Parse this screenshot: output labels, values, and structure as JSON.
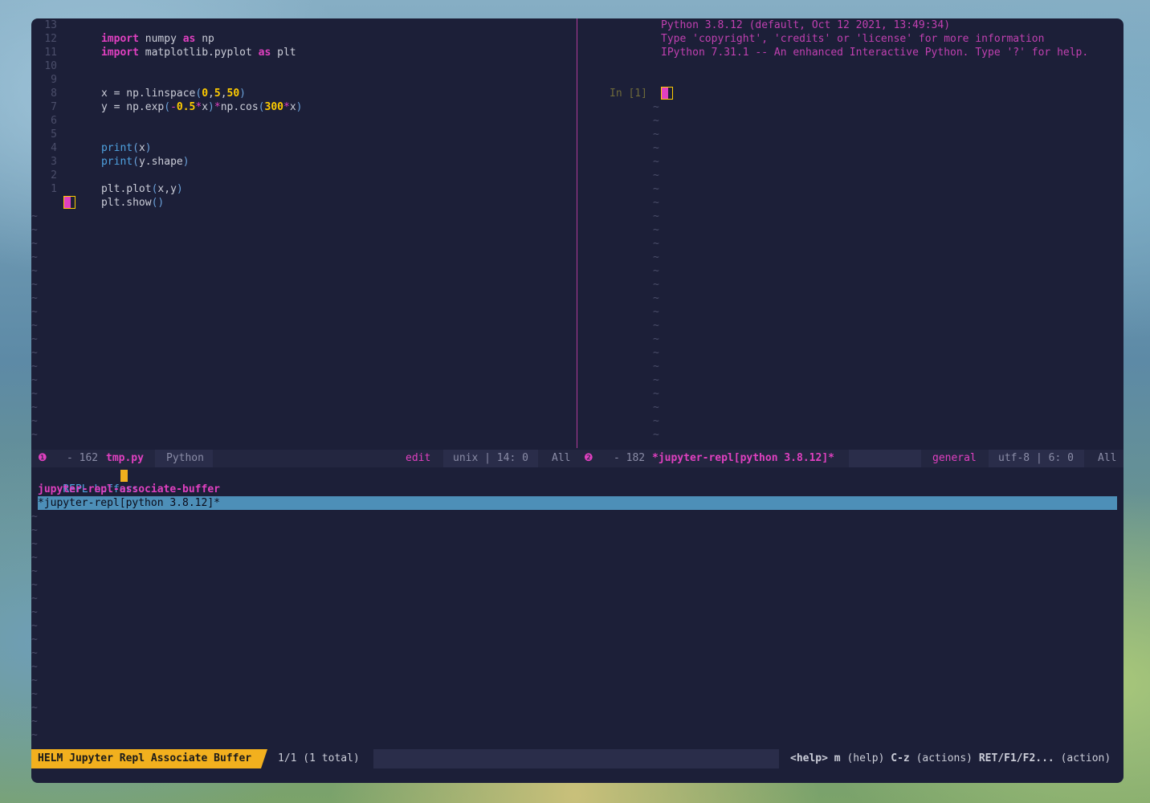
{
  "left_pane": {
    "lines": [
      {
        "gutter": "13"
      },
      {
        "gutter": "12"
      },
      {
        "gutter": "11"
      },
      {
        "gutter": "10"
      },
      {
        "gutter": "9"
      },
      {
        "gutter": "8"
      },
      {
        "gutter": "7"
      },
      {
        "gutter": "6"
      },
      {
        "gutter": "5"
      },
      {
        "gutter": "4"
      },
      {
        "gutter": "3"
      },
      {
        "gutter": "2"
      },
      {
        "gutter": "1"
      }
    ],
    "code": {
      "l13_kw1": "import",
      "l13_mod": " numpy ",
      "l13_kw2": "as",
      "l13_alias": " np",
      "l12_kw1": "import",
      "l12_mod": " matplotlib.pyplot ",
      "l12_kw2": "as",
      "l12_alias": " plt",
      "l9_a": "x = np.linspace",
      "l9_p1": "(",
      "l9_n1": "0",
      "l9_c1": ",",
      "l9_n2": "5",
      "l9_c2": ",",
      "l9_n3": "50",
      "l9_p2": ")",
      "l8_a": "y = np.exp",
      "l8_p1": "(",
      "l8_op1": "-",
      "l8_n1": "0.5",
      "l8_op2": "*",
      "l8_x": "x",
      "l8_p2": ")",
      "l8_op3": "*",
      "l8_b": "np.cos",
      "l8_p3": "(",
      "l8_n2": "300",
      "l8_op4": "*",
      "l8_x2": "x",
      "l8_p4": ")",
      "l5_fn": "print",
      "l5_p1": "(",
      "l5_x": "x",
      "l5_p2": ")",
      "l4_fn": "print",
      "l4_p1": "(",
      "l4_x": "y.shape",
      "l4_p2": ")",
      "l2_a": "plt.plot",
      "l2_p1": "(",
      "l2_x": "x,y",
      "l2_p2": ")",
      "l1_a": "plt.show",
      "l1_p": "()"
    },
    "tilde": "~"
  },
  "right_pane": {
    "banner1": "Python 3.8.12 (default, Oct 12 2021, 13:49:34)",
    "banner2": "Type 'copyright', 'credits' or 'license' for more information",
    "banner3": "IPython 7.31.1 -- An enhanced Interactive Python. Type '?' for help.",
    "prompt": "In [1]",
    "tilde": "~"
  },
  "modeline": {
    "left_icon": "❶",
    "left_size": "- 162",
    "left_file": "tmp.py",
    "left_mode": "Python",
    "left_state": "edit",
    "left_enc": "unix | 14: 0",
    "left_pos": "All",
    "right_icon": "❷",
    "right_size": "- 182",
    "right_buffer": "*jupyter-repl[python 3.8.12]*",
    "right_state": "general",
    "right_enc": "utf-8 | 6: 0",
    "right_pos": "All"
  },
  "helm": {
    "prompt": "REPL buffer:",
    "source_header": "jupyter-repl-associate-buffer",
    "candidate": "*jupyter-repl[python 3.8.12]*",
    "title": "HELM Jupyter Repl Associate Buffer",
    "count": "1/1 (1 total)",
    "help_key1": "<help>",
    "help_m": "m",
    "help_txt1": "(help)",
    "help_key2": "C-z",
    "help_txt2": "(actions)",
    "help_key3": "RET/F1/F2...",
    "help_txt3": "(action)"
  },
  "colors": {
    "accent": "#e040c0",
    "number": "#ffcc00",
    "selection": "#4d8fb8",
    "helm_title_bg": "#f2b01e",
    "background": "#1c1f38"
  }
}
